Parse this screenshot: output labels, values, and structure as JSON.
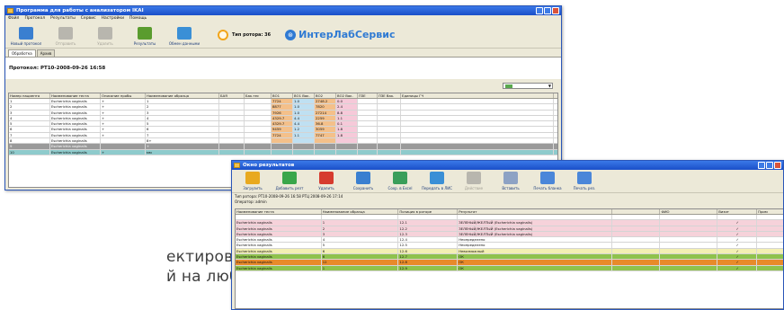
{
  "caption": {
    "line1": "ектировать",
    "line2": "й на любых"
  },
  "main_window": {
    "title": "Программа для работы с анализатором IKAI",
    "menu": [
      "Файл",
      "Протокол",
      "Результаты",
      "Сервис",
      "Настройки",
      "Помощь"
    ],
    "toolbar": [
      {
        "label": "Новый протокол",
        "disabled": false,
        "color": "#3a7fd0"
      },
      {
        "label": "Отправить",
        "disabled": true,
        "color": "#888"
      },
      {
        "label": "Удалить",
        "disabled": true,
        "color": "#888"
      },
      {
        "label": "Результаты",
        "disabled": false,
        "color": "#5a9c2e"
      },
      {
        "label": "Обмен данными",
        "disabled": false,
        "color": "#3a8fd6"
      }
    ],
    "timer_label": "Тип ротора: 36",
    "brand": "ИнтерЛабСервис",
    "tabs": [
      "Обработка",
      "Архив"
    ],
    "protocol_title": "Протокол: РТ10-2008-09-26 16:58",
    "grid": {
      "headers": [
        "Номер пациента",
        "Наименование теста",
        "Описание пробы",
        "Наименование образца",
        "БАЯ",
        "Бак.тес",
        "ВО1",
        "ВО1 Вак.",
        "ВО2",
        "ВО2 Вак.",
        "ПЗЕ",
        "ПЗЕ Вак.",
        "Единицы ГЧ"
      ],
      "rows": [
        {
          "cells": [
            "1",
            "Escherichia vaginalis",
            "+",
            "1",
            "",
            "",
            "7724",
            "1.0",
            "2748.2",
            "0.0",
            "",
            "",
            ""
          ],
          "kind": "normal"
        },
        {
          "cells": [
            "2",
            "Escherichia vaginalis",
            "+",
            "2",
            "",
            "",
            "8877",
            "1.0",
            "7820",
            "2.4",
            "",
            "",
            ""
          ],
          "kind": "normal"
        },
        {
          "cells": [
            "3",
            "Escherichia vaginalis",
            "+",
            "3",
            "",
            "",
            "7926",
            "1.0",
            "27214",
            "8.8",
            "",
            "",
            ""
          ],
          "kind": "normal"
        },
        {
          "cells": [
            "4",
            "Escherichia vaginalis",
            "+",
            "4",
            "",
            "",
            "4329.7",
            "4.4",
            "2259",
            "1.1",
            "",
            "",
            ""
          ],
          "kind": "normal"
        },
        {
          "cells": [
            "5",
            "Escherichia vaginalis",
            "+",
            "5",
            "",
            "",
            "4329.7",
            "4.4",
            "36.8",
            "0.1",
            "",
            "",
            ""
          ],
          "kind": "normal"
        },
        {
          "cells": [
            "6",
            "Escherichia vaginalis",
            "+",
            "6",
            "",
            "",
            "9459",
            "1.2",
            "3059",
            "1.8",
            "",
            "",
            ""
          ],
          "kind": "normal"
        },
        {
          "cells": [
            "7",
            "Escherichia vaginalis",
            "+",
            "7",
            "",
            "",
            "7724",
            "1.1",
            "7747",
            "1.8",
            "",
            "",
            ""
          ],
          "kind": "normal"
        },
        {
          "cells": [
            "8",
            "Escherichia vaginalis",
            "",
            "8+",
            "",
            "",
            "",
            "",
            "",
            "",
            "",
            "",
            ""
          ],
          "kind": "normal"
        },
        {
          "cells": [
            "9",
            "Escherichia vaginalis",
            "",
            "+",
            "",
            "",
            "",
            "",
            "",
            "",
            "",
            "",
            ""
          ],
          "kind": "selected"
        },
        {
          "cells": [
            "10",
            "Escherichia vaginalis",
            "+",
            "мм",
            "",
            "",
            "",
            "",
            "",
            "",
            "",
            "",
            ""
          ],
          "kind": "teal"
        }
      ]
    }
  },
  "results_window": {
    "title": "Окно результатов",
    "toolbar": [
      {
        "label": "Загрузить",
        "disabled": false,
        "color": "#e8a91f"
      },
      {
        "label": "Добавить резт",
        "disabled": false,
        "color": "#39a64a"
      },
      {
        "label": "Удалить",
        "disabled": false,
        "color": "#d63b2e"
      },
      {
        "label": "Сохранить",
        "disabled": false,
        "color": "#3a7fd0"
      },
      {
        "label": "Сохр. в Excel",
        "disabled": false,
        "color": "#3a9e5a"
      },
      {
        "label": "Передать в ЛИС",
        "disabled": false,
        "color": "#3a8fd6"
      },
      {
        "label": "Действие",
        "disabled": true,
        "color": "#888"
      },
      {
        "label": "Вставить",
        "disabled": false,
        "color": "#8da2c4"
      },
      {
        "label": "Печать бланка",
        "disabled": false,
        "color": "#4a86d9"
      },
      {
        "label": "Печать рез.",
        "disabled": false,
        "color": "#4a86d9"
      }
    ],
    "info_line1": "Тип ротора: РТ10-2008-09-26 16:58 РТЦ 2008-09-26 17:14",
    "info_line2": "Оператор: admin",
    "grid": {
      "headers": [
        "Наименование теста",
        "Наименование образца",
        "Позиция в роторе",
        "Результат",
        "",
        "ФИО",
        "Визит",
        "Прим"
      ],
      "rows": [
        {
          "cells": [
            "",
            "",
            "",
            "",
            "",
            "",
            "",
            ""
          ],
          "kind": "filter"
        },
        {
          "cells": [
            "Escherichia vaginalis",
            "1",
            "12.1",
            "ЗЕЛЕНЫЙ/ЖЕЛТЫЙ (Escherichia vaginalis)",
            "",
            "",
            "✓",
            ""
          ],
          "kind": "pink"
        },
        {
          "cells": [
            "Escherichia vaginalis",
            "2",
            "12.2",
            "ЗЕЛЕНЫЙ/ЖЕЛТЫЙ (Escherichia vaginalis)",
            "",
            "",
            "✓",
            ""
          ],
          "kind": "pink"
        },
        {
          "cells": [
            "Escherichia vaginalis",
            "3",
            "12.3",
            "ЗЕЛЕНЫЙ/ЖЕЛТЫЙ (Escherichia vaginalis)",
            "",
            "",
            "✓",
            ""
          ],
          "kind": "pink"
        },
        {
          "cells": [
            "Escherichia vaginalis",
            "4",
            "12.4",
            "Неопределено",
            "",
            "",
            "✓",
            ""
          ],
          "kind": "white"
        },
        {
          "cells": [
            "Escherichia vaginalis",
            "5",
            "12.5",
            "Неопределено",
            "",
            "",
            "✓",
            ""
          ],
          "kind": "white"
        },
        {
          "cells": [
            "Escherichia vaginalis",
            "6",
            "12.6",
            "Невозможный",
            "",
            "",
            "✓",
            ""
          ],
          "kind": "yellow"
        },
        {
          "cells": [
            "Escherichia vaginalis",
            "6",
            "12.7",
            "ОК",
            "",
            "",
            "✓",
            ""
          ],
          "kind": "green"
        },
        {
          "cells": [
            "Escherichia vaginalis",
            "12",
            "12.8",
            "ОК",
            "",
            "",
            "✓",
            ""
          ],
          "kind": "orange"
        },
        {
          "cells": [
            "Escherichia vaginalis",
            "1",
            "12.9",
            "ОК",
            "",
            "",
            "✓",
            ""
          ],
          "kind": "green"
        }
      ]
    }
  },
  "colors": {
    "titlebar": "#1a4fc8",
    "row_selected": "#9a9a9a",
    "row_teal": "#8ecbcc",
    "row_pink": "#f6d2da",
    "row_yellow": "#f3efb3",
    "row_green": "#8fc24c",
    "row_orange": "#e88a2a",
    "cell_orange": "#f4c08a",
    "cell_blue": "#bfe0f2",
    "cell_pink": "#f6c9d9"
  }
}
